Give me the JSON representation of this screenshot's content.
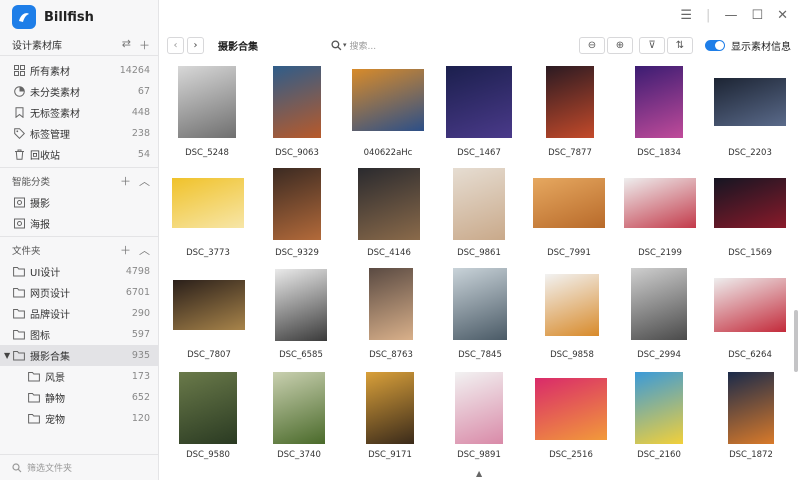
{
  "app": {
    "name": "Billfish"
  },
  "library": {
    "title": "设计素材库"
  },
  "nav": [
    {
      "label": "所有素材",
      "count": "14264",
      "icon": "grid-icon"
    },
    {
      "label": "未分类素材",
      "count": "67",
      "icon": "pie-icon"
    },
    {
      "label": "无标签素材",
      "count": "448",
      "icon": "bookmark-icon"
    },
    {
      "label": "标签管理",
      "count": "238",
      "icon": "tag-icon"
    },
    {
      "label": "回收站",
      "count": "54",
      "icon": "trash-icon"
    }
  ],
  "smart": {
    "title": "智能分类",
    "items": [
      {
        "label": "摄影"
      },
      {
        "label": "海报"
      }
    ]
  },
  "folders": {
    "title": "文件夹",
    "items": [
      {
        "label": "UI设计",
        "count": "4798"
      },
      {
        "label": "网页设计",
        "count": "6701"
      },
      {
        "label": "品牌设计",
        "count": "290"
      },
      {
        "label": "图标",
        "count": "597"
      },
      {
        "label": "摄影合集",
        "count": "935"
      }
    ],
    "children": [
      {
        "label": "风景",
        "count": "173"
      },
      {
        "label": "静物",
        "count": "652"
      },
      {
        "label": "宠物",
        "count": "120"
      }
    ]
  },
  "sidebar_filter": {
    "placeholder": "筛选文件夹"
  },
  "toolbar": {
    "breadcrumb": "摄影合集",
    "search_placeholder": "搜索...",
    "toggle_label": "显示素材信息",
    "toggle_on": true
  },
  "grid": [
    [
      {
        "name": "DSC_5248",
        "colors": [
          "#d8d8d8",
          "#6f6f6f"
        ]
      },
      {
        "name": "DSC_9063",
        "colors": [
          "#2f5d8a",
          "#b85a2a"
        ]
      },
      {
        "name": "040622aHc",
        "colors": [
          "#d88b2a",
          "#2c4f88"
        ]
      },
      {
        "name": "DSC_1467",
        "colors": [
          "#1b1f4d",
          "#4a3a8a"
        ]
      },
      {
        "name": "DSC_7877",
        "colors": [
          "#2b1a22",
          "#c44a2a"
        ]
      },
      {
        "name": "DSC_1834",
        "colors": [
          "#3b1c72",
          "#c04b9a"
        ]
      },
      {
        "name": "DSC_2203",
        "colors": [
          "#1c2433",
          "#5a6a8a"
        ]
      }
    ],
    [
      {
        "name": "DSC_3773",
        "colors": [
          "#f0c22a",
          "#f7e6a8"
        ]
      },
      {
        "name": "DSC_9329",
        "colors": [
          "#3b2a22",
          "#b36a3a"
        ]
      },
      {
        "name": "DSC_4146",
        "colors": [
          "#2a2a2e",
          "#8a6a4a"
        ]
      },
      {
        "name": "DSC_9861",
        "colors": [
          "#e6ddd2",
          "#c9a98a"
        ]
      },
      {
        "name": "DSC_7991",
        "colors": [
          "#e6a860",
          "#b86a2a"
        ]
      },
      {
        "name": "DSC_2199",
        "colors": [
          "#eeeeee",
          "#c33a4a"
        ]
      },
      {
        "name": "DSC_1569",
        "colors": [
          "#151522",
          "#8a1a2a"
        ]
      }
    ],
    [
      {
        "name": "DSC_7807",
        "colors": [
          "#2a1f1a",
          "#a8844a"
        ]
      },
      {
        "name": "DSC_6585",
        "colors": [
          "#eaeaea",
          "#3a3a3a"
        ]
      },
      {
        "name": "DSC_8763",
        "colors": [
          "#5a4a42",
          "#d9b08a"
        ]
      },
      {
        "name": "DSC_7845",
        "colors": [
          "#c9d3d9",
          "#4a5a66"
        ]
      },
      {
        "name": "DSC_9858",
        "colors": [
          "#f2f2f2",
          "#d88a2a"
        ]
      },
      {
        "name": "DSC_2994",
        "colors": [
          "#cfcfcf",
          "#4a4a4a"
        ]
      },
      {
        "name": "DSC_6264",
        "colors": [
          "#eeeeee",
          "#c32a3a"
        ]
      }
    ],
    [
      {
        "name": "DSC_9580",
        "colors": [
          "#6a7a4a",
          "#2a3a22"
        ]
      },
      {
        "name": "DSC_3740",
        "colors": [
          "#c9d0b0",
          "#4a6a2a"
        ]
      },
      {
        "name": "DSC_9171",
        "colors": [
          "#d9a03a",
          "#3a2a1a"
        ]
      },
      {
        "name": "DSC_9891",
        "colors": [
          "#f2f2f2",
          "#d98aa8"
        ]
      },
      {
        "name": "DSC_2516",
        "colors": [
          "#d92a6a",
          "#f29a3a"
        ]
      },
      {
        "name": "DSC_2160",
        "colors": [
          "#3a9ad9",
          "#f2d03a"
        ]
      },
      {
        "name": "DSC_1872",
        "colors": [
          "#1a2a4a",
          "#d97a2a"
        ]
      }
    ]
  ]
}
